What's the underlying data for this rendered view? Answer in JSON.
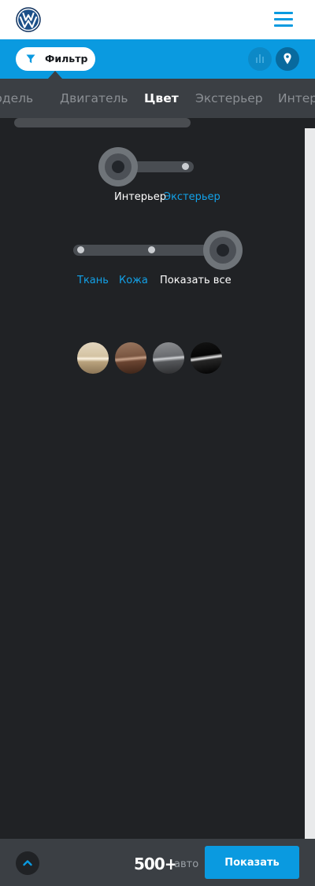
{
  "header": {
    "logo_icon": "volkswagen-logo",
    "menu_icon": "hamburger-menu-icon"
  },
  "filterbar": {
    "filter_label": "Фильтр",
    "filter_icon": "funnel-icon",
    "chart_icon": "bar-chart-icon",
    "pin_icon": "map-pin-icon"
  },
  "tabs": [
    {
      "label": "Модель",
      "active": false
    },
    {
      "label": "Двигатель",
      "active": false
    },
    {
      "label": "Цвет",
      "active": true
    },
    {
      "label": "Экстерьер",
      "active": false
    },
    {
      "label": "Интерьер",
      "active": false
    }
  ],
  "color_panel": {
    "location_toggle": {
      "options": [
        "Интерьер",
        "Экстерьер"
      ],
      "selected": "Интерьер"
    },
    "material_slider": {
      "options": [
        "Ткань",
        "Кожа",
        "Показать все"
      ],
      "selected": "Показать все"
    },
    "swatches": [
      {
        "name": "beige",
        "color": "#c9b79a"
      },
      {
        "name": "brown",
        "color": "#7a5a46"
      },
      {
        "name": "grey",
        "color": "#6f7174"
      },
      {
        "name": "black",
        "color": "#050505"
      }
    ]
  },
  "footer": {
    "count": "500+",
    "count_unit": "авто",
    "show_label": "Показать",
    "up_icon": "chevron-up-icon"
  },
  "colors": {
    "brand_blue": "#0a9ae0",
    "dark_bg": "#202225",
    "bar_grey": "#3b3f44"
  }
}
